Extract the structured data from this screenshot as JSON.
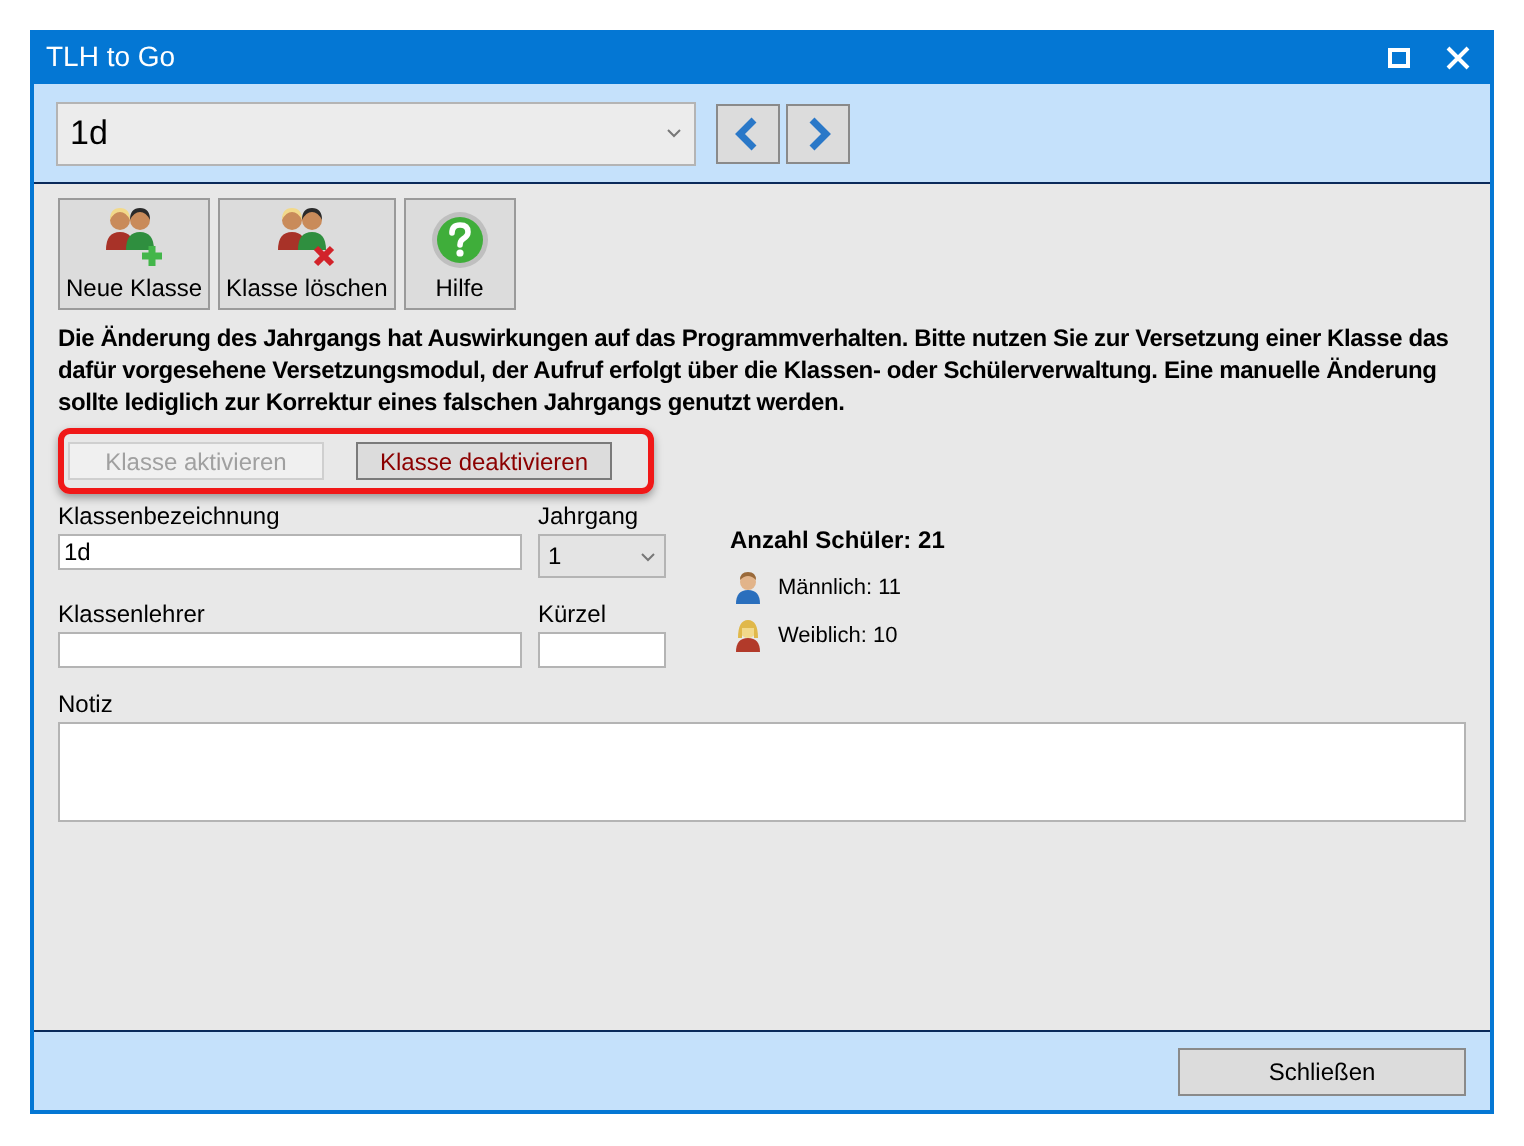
{
  "window": {
    "title": "TLH to Go"
  },
  "class_select": {
    "value": "1d"
  },
  "toolbar": [
    {
      "label": "Neue Klasse",
      "kind": "add"
    },
    {
      "label": "Klasse löschen",
      "kind": "delete"
    },
    {
      "label": "Hilfe",
      "kind": "help"
    }
  ],
  "notice": "Die Änderung des Jahrgangs hat Auswirkungen auf das Programmverhalten. Bitte nutzen Sie zur Versetzung einer Klasse das dafür vorgesehene Versetzungsmodul, der Aufruf erfolgt über die Klassen- oder Schülerverwaltung. Eine manuelle Änderung sollte lediglich zur Korrektur eines falschen Jahrgangs genutzt werden.",
  "status_buttons": [
    {
      "label": "Klasse aktivieren",
      "disabled": true
    },
    {
      "label": "Klasse deaktivieren",
      "disabled": false
    }
  ],
  "form": {
    "class_name": {
      "label": "Klassenbezeichnung",
      "value": "1d"
    },
    "year": {
      "label": "Jahrgang",
      "value": "1"
    },
    "teacher": {
      "label": "Klassenlehrer"
    },
    "short": {
      "label": "Kürzel"
    },
    "note": {
      "label": "Notiz"
    }
  },
  "stats": {
    "title": "Anzahl Schüler: 21",
    "items": [
      {
        "label": "Männlich: 11",
        "kind": "male"
      },
      {
        "label": "Weiblich: 10",
        "kind": "female"
      }
    ]
  },
  "footer": {
    "close": "Schließen"
  }
}
